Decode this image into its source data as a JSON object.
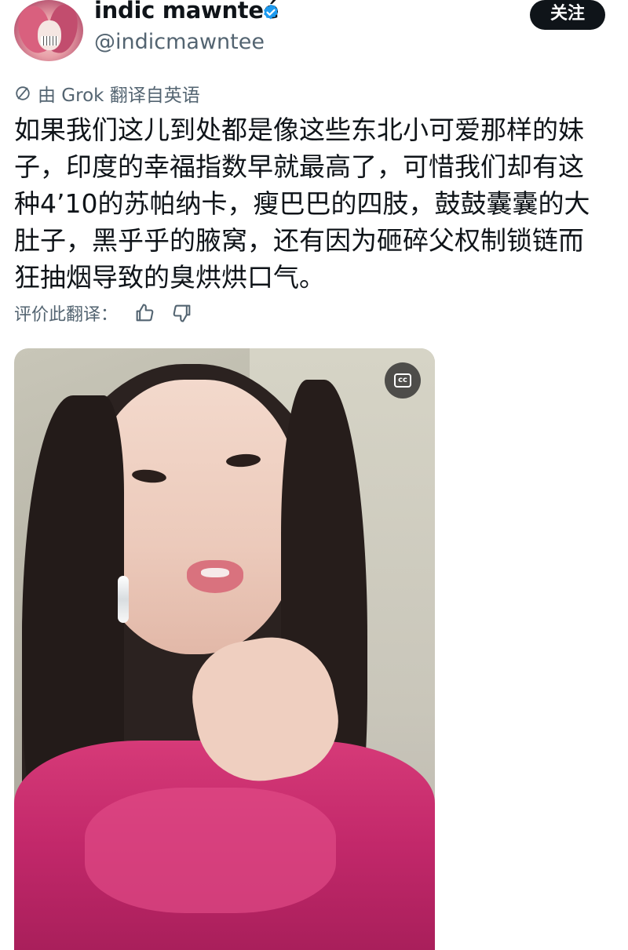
{
  "author": {
    "display_name": "indic mawnteé",
    "handle": "@indicmawntee",
    "verified": true,
    "follow_label": "关注"
  },
  "translation": {
    "label": "由 Grok 翻译自英语",
    "icon": "translate-icon",
    "rate_label": "评价此翻译：",
    "thumbs_up_icon": "thumbs-up-icon",
    "thumbs_down_icon": "thumbs-down-icon"
  },
  "tweet": {
    "text": "如果我们这儿到处都是像这些东北小可爱那样的妹\n子，印度的幸福指数早就最高了，可惜我们却有这\n种4’10的苏帕纳卡，瘦巴巴的四肢，鼓鼓囊囊的大\n肚子，黑乎乎的腋窝，还有因为砸碎父权制锁链而\n狂抽烟导致的臭烘烘口气。"
  },
  "media": {
    "type": "video",
    "cc_label": "cc"
  },
  "colors": {
    "text": "#0f1419",
    "secondary": "#536471",
    "follow_bg": "#0f1419",
    "verified": "#1d9bf0"
  }
}
